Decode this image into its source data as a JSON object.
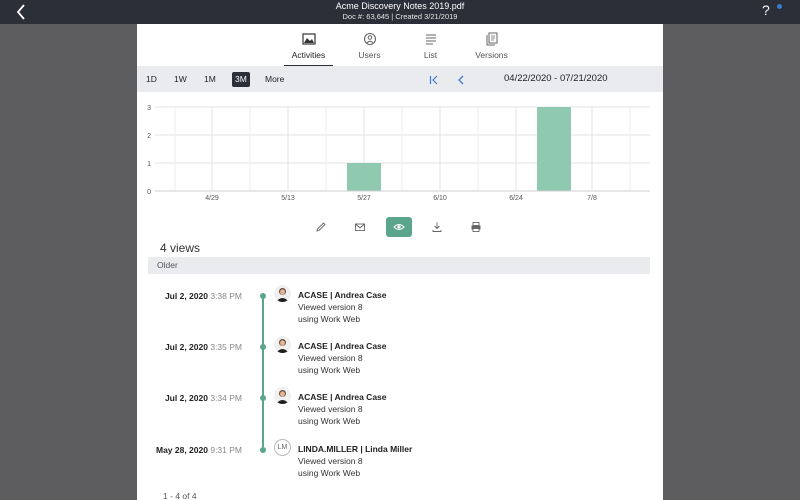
{
  "header": {
    "title": "Acme Discovery Notes 2019.pdf",
    "meta": "Doc #: 63,645 | Created 3/21/2019",
    "back_icon": "chevron-left-icon",
    "help_icon": "question-icon"
  },
  "tabs": [
    {
      "label": "Activities",
      "icon": "chart-image-icon",
      "active": true
    },
    {
      "label": "Users",
      "icon": "globe-user-icon",
      "active": false
    },
    {
      "label": "List",
      "icon": "list-icon",
      "active": false
    },
    {
      "label": "Versions",
      "icon": "versions-icon",
      "active": false
    }
  ],
  "range": {
    "buttons": [
      "1D",
      "1W",
      "1M",
      "3M",
      "More"
    ],
    "selected": "3M",
    "date_range": "04/22/2020 - 07/21/2020"
  },
  "chart_data": {
    "type": "bar",
    "x_tick_labels": [
      "4/29",
      "5/13",
      "5/27",
      "6/10",
      "6/24",
      "7/8"
    ],
    "y_tick_labels": [
      "0",
      "1",
      "2",
      "3"
    ],
    "ylim": [
      0,
      3
    ],
    "bars": [
      {
        "week_of": "5/27",
        "value": 1
      },
      {
        "week_of": "6/24-7/8",
        "value": 3
      }
    ],
    "color": "#8fcab0",
    "grid": true
  },
  "toolbar": {
    "tools": [
      "pencil-icon",
      "mail-icon",
      "eye-icon",
      "download-icon",
      "print-icon"
    ],
    "active": "eye-icon"
  },
  "views": {
    "count_label": "4 views",
    "group_label": "Older",
    "entries": [
      {
        "date": "Jul 2, 2020",
        "time": "3:38 PM",
        "user": "ACASE | Andrea Case",
        "line1": "Viewed version 8",
        "line2": "using Work Web",
        "avatar": "photo"
      },
      {
        "date": "Jul 2, 2020",
        "time": "3:35 PM",
        "user": "ACASE | Andrea Case",
        "line1": "Viewed version 8",
        "line2": "using Work Web",
        "avatar": "photo"
      },
      {
        "date": "Jul 2, 2020",
        "time": "3:34 PM",
        "user": "ACASE | Andrea Case",
        "line1": "Viewed version 8",
        "line2": "using Work Web",
        "avatar": "photo"
      },
      {
        "date": "May 28, 2020",
        "time": "9:31 PM",
        "user": "LINDA.MILLER | Linda Miller",
        "line1": "Viewed version 8",
        "line2": "using Work Web",
        "avatar": "initials",
        "initials": "LM"
      }
    ],
    "pagination": "1 - 4 of 4"
  },
  "colors": {
    "topbar": "#2b2f38",
    "accent": "#5aa58b",
    "bar": "#8fcab0",
    "link_blue": "#3a7bd5"
  }
}
